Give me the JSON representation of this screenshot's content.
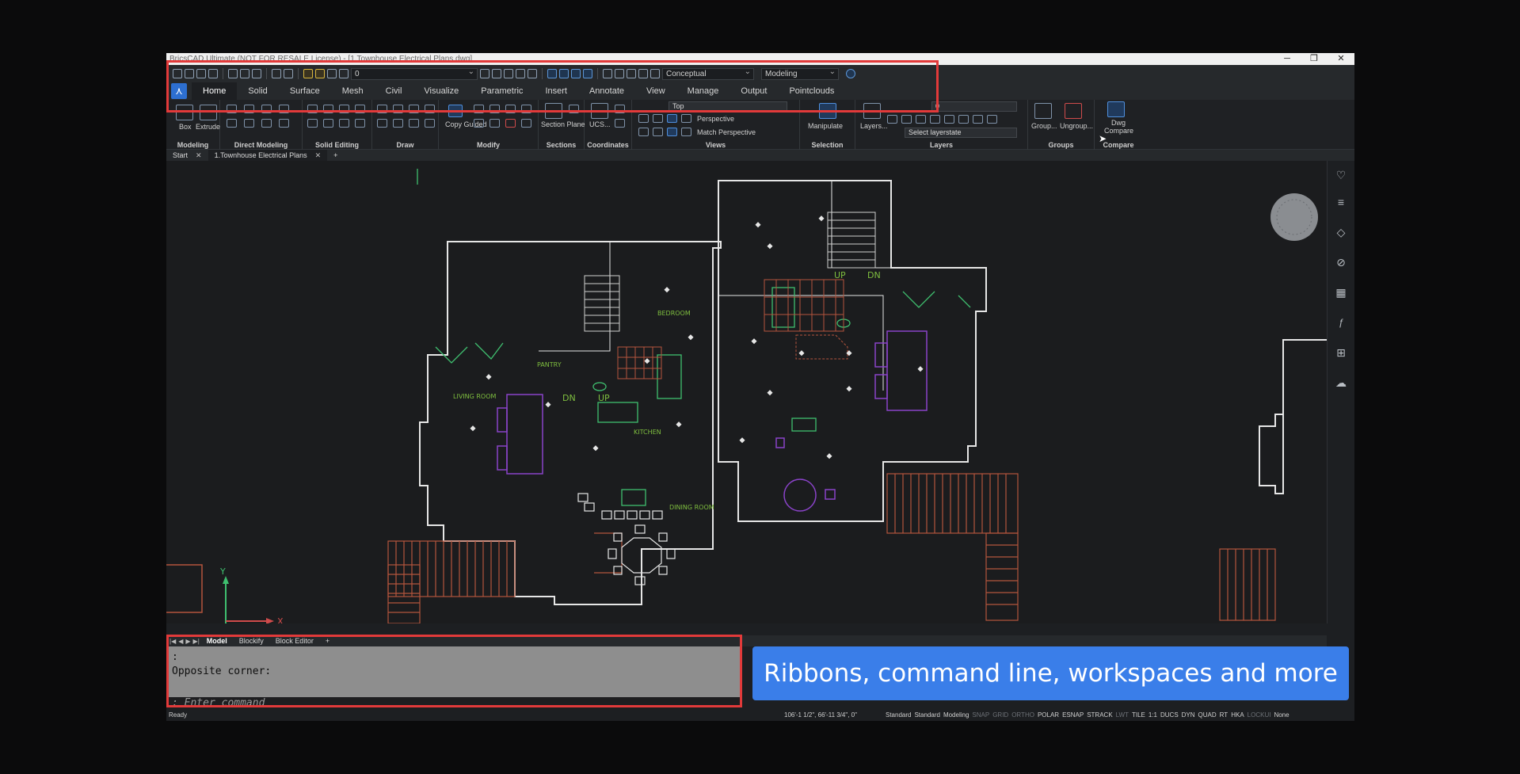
{
  "window": {
    "title": "BricsCAD Ultimate (NOT FOR RESALE License) - [1.Townhouse Electrical Plans.dwg]",
    "controls": [
      "─",
      "❐",
      "✕"
    ]
  },
  "qat": {
    "layer_value": "0",
    "visual_style": "Conceptual",
    "workspace": "Modeling"
  },
  "ribbon_tabs": [
    "Home",
    "Solid",
    "Surface",
    "Mesh",
    "Civil",
    "Visualize",
    "Parametric",
    "Insert",
    "Annotate",
    "View",
    "Manage",
    "Output",
    "Pointclouds"
  ],
  "ribbon": {
    "groups": {
      "modeling": "Modeling",
      "direct_modeling": "Direct Modeling",
      "solid_editing": "Solid Editing",
      "draw": "Draw",
      "modify": "Modify",
      "sections": "Sections",
      "coordinates": "Coordinates",
      "views": "Views",
      "selection": "Selection",
      "layers": "Layers",
      "groups": "Groups",
      "compare": "Compare"
    },
    "buttons": {
      "box": "Box",
      "extrude": "Extrude",
      "copy_guided": "Copy Guided",
      "section_plane": "Section Plane",
      "ucs": "UCS...",
      "view_top": "Top",
      "perspective": "Perspective",
      "match_perspective": "Match Perspective",
      "manipulate": "Manipulate",
      "layers": "Layers...",
      "layer_value": "0",
      "select_layerstate": "Select layerstate",
      "group": "Group...",
      "ungroup": "Ungroup...",
      "dwg_compare": "Dwg Compare"
    }
  },
  "doc_tabs": {
    "start": "Start",
    "drawing": "1.Townhouse Electrical Plans",
    "add": "+"
  },
  "drawing_labels": {
    "bedroom": "BEDROOM",
    "pantry": "PANTRY",
    "living_room": "LIVING ROOM",
    "kitchen": "KITCHEN",
    "dining_room": "DINING ROOM",
    "up_left": "UP",
    "dn_left": "DN",
    "up_right": "UP",
    "dn_right": "DN",
    "axis_x": "X",
    "axis_y": "Y"
  },
  "layout_tabs": {
    "model": "Model",
    "blockify": "Blockify",
    "block_editor": "Block Editor",
    "add": "+"
  },
  "command_line": {
    "line1": ":",
    "line2": "Opposite corner:",
    "prompt": ": Enter command"
  },
  "status_bar": {
    "ready": "Ready",
    "coordinates": "106'-1 1/2\", 66'-11 3/4\", 0\"",
    "items": [
      {
        "label": "Standard",
        "on": true
      },
      {
        "label": "Standard",
        "on": true
      },
      {
        "label": "Modeling",
        "on": true
      },
      {
        "label": "SNAP",
        "on": false
      },
      {
        "label": "GRID",
        "on": false
      },
      {
        "label": "ORTHO",
        "on": false
      },
      {
        "label": "POLAR",
        "on": true
      },
      {
        "label": "ESNAP",
        "on": true
      },
      {
        "label": "STRACK",
        "on": true
      },
      {
        "label": "LWT",
        "on": false
      },
      {
        "label": "TILE",
        "on": true
      },
      {
        "label": "1:1",
        "on": true
      },
      {
        "label": "DUCS",
        "on": true
      },
      {
        "label": "DYN",
        "on": true
      },
      {
        "label": "QUAD",
        "on": true
      },
      {
        "label": "RT",
        "on": true
      },
      {
        "label": "HKA",
        "on": true
      },
      {
        "label": "LOCKUI",
        "on": false
      },
      {
        "label": "None",
        "on": true
      }
    ]
  },
  "caption": "Ribbons, command line, workspaces and more",
  "colors": {
    "highlight": "#e23a3a",
    "caption_bg": "#3a7ee9",
    "wall": "#e6e6e6",
    "furniture": "#8a43c9",
    "fixtures": "#3fbf6f",
    "stairs": "#b4553d"
  }
}
